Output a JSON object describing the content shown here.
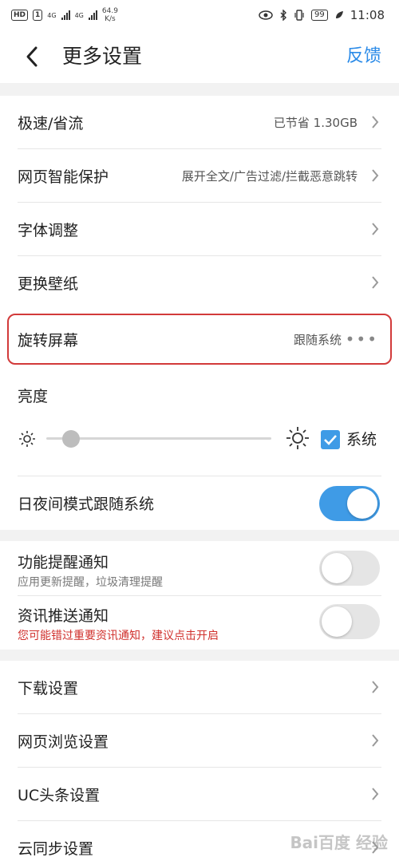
{
  "status_bar": {
    "hd_badge": "HD",
    "sim_badge": "1",
    "net_1": "4G",
    "net_2": "4G",
    "speed_value": "64.9",
    "speed_unit": "K/s",
    "battery": "99",
    "time": "11:08"
  },
  "header": {
    "title": "更多设置",
    "feedback": "反馈"
  },
  "settings": {
    "speed_saving": {
      "label": "极速/省流",
      "value": "已节省 1.30GB"
    },
    "web_protect": {
      "label": "网页智能保护",
      "value": "展开全文/广告过滤/拦截恶意跳转"
    },
    "font_adjust": {
      "label": "字体调整"
    },
    "wallpaper": {
      "label": "更换壁纸"
    },
    "rotate_screen": {
      "label": "旋转屏幕",
      "value": "跟随系统"
    },
    "brightness": {
      "label": "亮度",
      "system_label": "系统",
      "system_checked": true,
      "level": 0.11
    },
    "night_mode": {
      "label": "日夜间模式跟随系统",
      "enabled": true
    }
  },
  "notifications": {
    "feature_reminder": {
      "label": "功能提醒通知",
      "sub": "应用更新提醒，垃圾清理提醒",
      "enabled": false
    },
    "news_push": {
      "label": "资讯推送通知",
      "warning": "您可能错过重要资讯通知，建议点击开启",
      "enabled": false
    }
  },
  "more": {
    "download": {
      "label": "下载设置"
    },
    "browsing": {
      "label": "网页浏览设置"
    },
    "uc_headline": {
      "label": "UC头条设置"
    },
    "cloud_sync": {
      "label": "云同步设置"
    }
  },
  "watermark": "Bai百度 经验",
  "colors": {
    "accent": "#3f9be6",
    "highlight_border": "#d23a3a",
    "warning": "#d0302c",
    "feedback": "#2b8be8"
  }
}
